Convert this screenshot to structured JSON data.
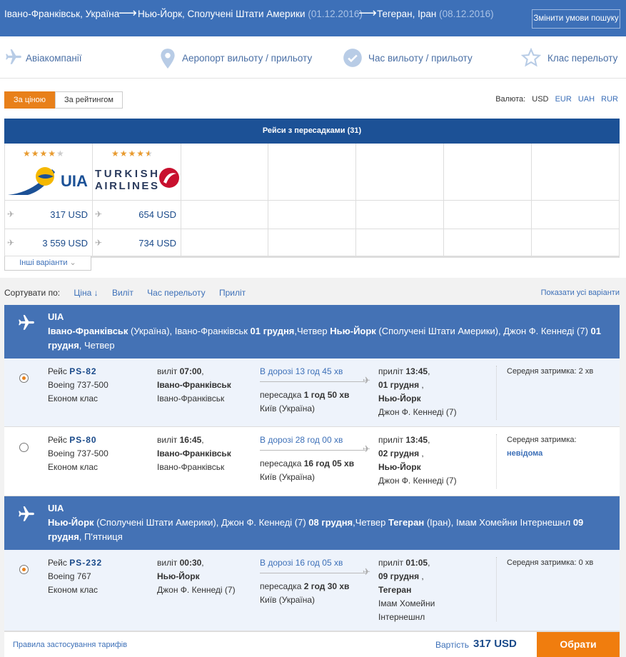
{
  "route": {
    "origin": "Івано-Франківськ, Україна",
    "dest1": "Нью-Йорк, Сполучені Штати Америки",
    "date1": "(01.12.2016)",
    "dest2": "Тегеран, Іран",
    "date2": "(08.12.2016)",
    "arrow": "⟶",
    "change_button": "Змінити умови пошуку"
  },
  "filters": [
    {
      "label": "Авіакомпанії",
      "icon": "plane-icon"
    },
    {
      "label": "Аеропорт вильоту / прильоту",
      "icon": "location-pin-icon"
    },
    {
      "label": "Час вильоту / прильоту",
      "icon": "check-circle-icon"
    },
    {
      "label": "Клас перельоту",
      "icon": "star-icon"
    }
  ],
  "sort_tabs": {
    "by_price": "За ціною",
    "by_rating": "За рейтингом"
  },
  "currency": {
    "label": "Валюта:",
    "options": [
      "USD",
      "EUR",
      "UAH",
      "RUR"
    ],
    "selected": "USD"
  },
  "matrix": {
    "title": "Рейси з пересадками (31)",
    "airlines": [
      {
        "name": "UIA",
        "stars": "★★★★★",
        "rating": 4,
        "prices": [
          "317 USD",
          "3 559 USD"
        ]
      },
      {
        "name": "TURKISH AIRLINES",
        "stars": "★★★★★",
        "rating": 4.5,
        "prices": [
          "654 USD",
          "734 USD"
        ]
      }
    ],
    "other_button": "Інші варіанти",
    "chevron": "⌄"
  },
  "sorting": {
    "label": "Сортувати по:",
    "options": [
      "Ціна ↓",
      "Виліт",
      "Час перельоту",
      "Приліт"
    ],
    "show_all": "Показати усі варіанти"
  },
  "segments": [
    {
      "airline": "UIA",
      "from_city": "Івано-Франківськ",
      "from_country": " (Україна), Івано-Франківськ ",
      "from_date": "01 грудня",
      "from_day": ",Четвер ",
      "to_city": "Нью-Йорк",
      "to_country": " (Сполучені Штати Америки), Джон Ф. Кеннеді (7) ",
      "to_date": "01 грудня",
      "to_day": ", Четвер",
      "flights": [
        {
          "selected": true,
          "flight_label": "Рейс",
          "flight_no": "PS-82",
          "aircraft": "Boeing 737-500",
          "class": "Економ клас",
          "dep_label": "виліт",
          "dep_time": "07:00",
          "dep_city": "Івано-Франківськ",
          "dep_airport": "Івано-Франківськ",
          "duration": "В дорозі 13 год 45 хв",
          "transfer_label": "пересадка",
          "transfer_time": "1 год 50 хв",
          "transfer_city": "Київ (Україна)",
          "arr_label": "приліт",
          "arr_time": "13:45",
          "arr_date": "01 грудня",
          "arr_city": "Нью-Йорк",
          "arr_airport": "Джон Ф. Кеннеді (7)",
          "delay_label": "Середня затримка:",
          "delay_value": "2 хв"
        },
        {
          "selected": false,
          "flight_label": "Рейс",
          "flight_no": "PS-80",
          "aircraft": "Boeing 737-500",
          "class": "Економ клас",
          "dep_label": "виліт",
          "dep_time": "16:45",
          "dep_city": "Івано-Франківськ",
          "dep_airport": "Івано-Франківськ",
          "duration": "В дорозі 28 год 00 хв",
          "transfer_label": "пересадка",
          "transfer_time": "16 год 05 хв",
          "transfer_city": "Київ (Україна)",
          "arr_label": "приліт",
          "arr_time": "13:45",
          "arr_date": "02 грудня",
          "arr_city": "Нью-Йорк",
          "arr_airport": "Джон Ф. Кеннеді (7)",
          "delay_label": "Середня затримка:",
          "delay_value": "невідома"
        }
      ]
    },
    {
      "airline": "UIA",
      "from_city": "Нью-Йорк",
      "from_country": " (Сполучені Штати Америки), Джон Ф. Кеннеді (7) ",
      "from_date": "08 грудня",
      "from_day": ",Четвер ",
      "to_city": "Тегеран",
      "to_country": " (Іран), Імам Хомейни Інтернешнл ",
      "to_date": "09 грудня",
      "to_day": ", П'ятниця",
      "flights": [
        {
          "selected": true,
          "flight_label": "Рейс",
          "flight_no": "PS-232",
          "aircraft": "Boeing 767",
          "class": "Економ клас",
          "dep_label": "виліт",
          "dep_time": "00:30",
          "dep_city": "Нью-Йорк",
          "dep_airport": "Джон Ф. Кеннеді (7)",
          "duration": "В дорозі 16 год 05 хв",
          "transfer_label": "пересадка",
          "transfer_time": "2 год 30 хв",
          "transfer_city": "Київ (Україна)",
          "arr_label": "приліт",
          "arr_time": "01:05",
          "arr_date": "09 грудня",
          "arr_city": "Тегеран",
          "arr_airport_1": "Імам Хомейни",
          "arr_airport_2": "Інтернешнл",
          "delay_label": "Середня затримка:",
          "delay_value": "0 хв"
        }
      ]
    }
  ],
  "footer": {
    "rules": "Правила застосування тарифів",
    "price_label": "Вартість",
    "price": "317 USD",
    "choose": "Обрати"
  },
  "colors": {
    "brand_blue": "#3d70b8",
    "dark_blue": "#1c5196",
    "accent_orange": "#f07d0e"
  }
}
